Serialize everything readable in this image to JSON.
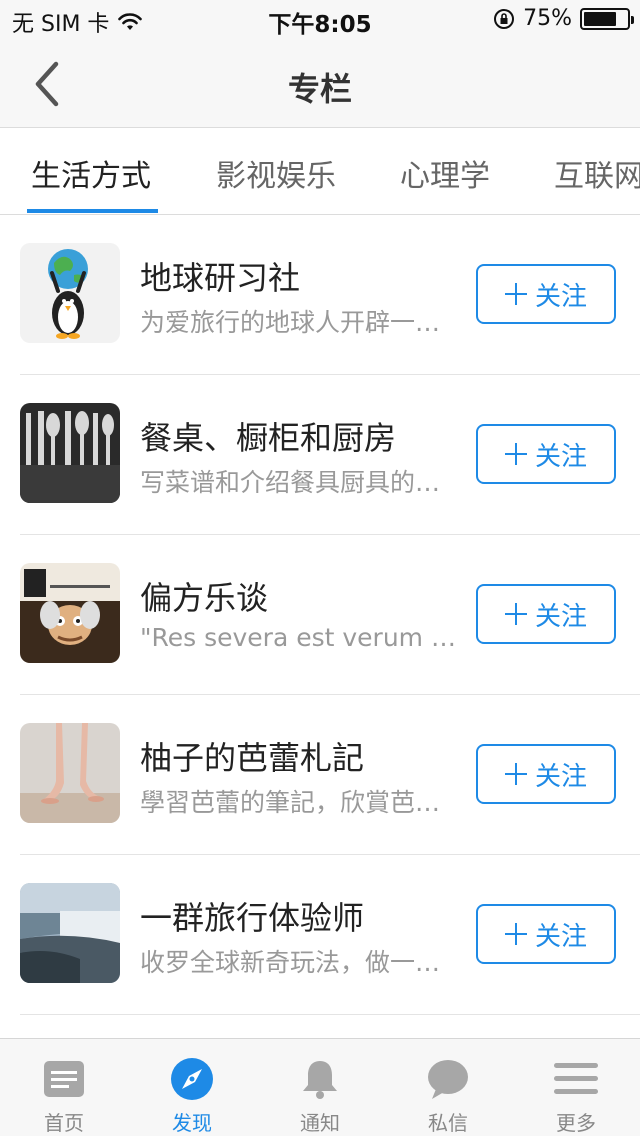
{
  "status_bar": {
    "carrier": "无 SIM 卡",
    "time": "下午8:05",
    "battery": "75%",
    "battery_level": 0.75
  },
  "nav": {
    "title": "专栏"
  },
  "category_tabs": [
    {
      "label": "生活方式",
      "active": true
    },
    {
      "label": "影视娱乐",
      "active": false
    },
    {
      "label": "心理学",
      "active": false
    },
    {
      "label": "互联网",
      "active": false
    }
  ],
  "columns": [
    {
      "title": "地球研习社",
      "description": "为爱旅行的地球人开辟一个交流的空间",
      "follow_label": "关注",
      "thumb": "globe-penguin-image"
    },
    {
      "title": "餐桌、橱柜和厨房",
      "description": "写菜谱和介绍餐具厨具的专栏",
      "follow_label": "关注",
      "thumb": "cutlery-image"
    },
    {
      "title": "偏方乐谈",
      "description": "\"Res severa est verum gaudium\"",
      "follow_label": "关注",
      "thumb": "music-book-cover-image"
    },
    {
      "title": "柚子的芭蕾札記",
      "description": "學習芭蕾的筆記，欣賞芭蕾的心得",
      "follow_label": "关注",
      "thumb": "ballet-feet-image"
    },
    {
      "title": "一群旅行体验师",
      "description": "收罗全球新奇玩法，做一群旅行体验师",
      "follow_label": "关注",
      "thumb": "waterfall-image"
    }
  ],
  "bottom_tabs": [
    {
      "label": "首页",
      "icon": "home-icon",
      "active": false
    },
    {
      "label": "发现",
      "icon": "compass-icon",
      "active": true
    },
    {
      "label": "通知",
      "icon": "bell-icon",
      "active": false
    },
    {
      "label": "私信",
      "icon": "chat-bubble-icon",
      "active": false
    },
    {
      "label": "更多",
      "icon": "menu-icon",
      "active": false
    }
  ],
  "colors": {
    "accent": "#1e8ae6",
    "inactive": "#a7a7a7"
  }
}
